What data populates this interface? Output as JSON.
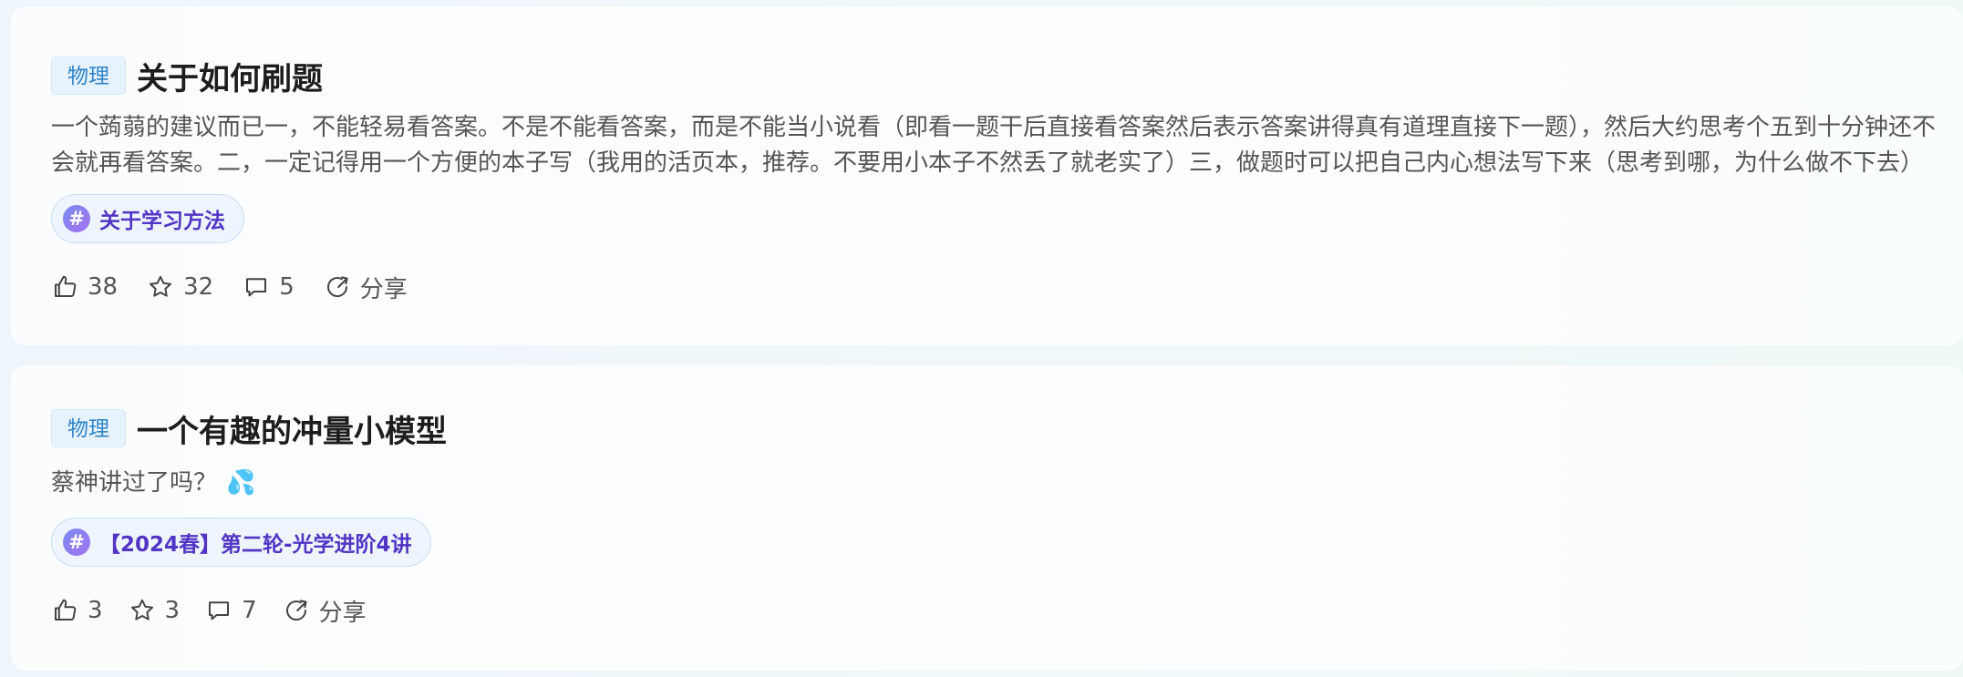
{
  "posts": [
    {
      "subject": "物理",
      "title": "关于如何刷题",
      "excerpt": "一个蒟蒻的建议而已一，不能轻易看答案。不是不能看答案，而是不能当小说看（即看一题干后直接看答案然后表示答案讲得真有道理直接下一题），然后大约思考个五到十分钟还不会就再看答案。二，一定记得用一个方便的本子写（我用的活页本，推荐。不要用小本子不然丢了就老实了）三，做题时可以把自己内心想法写下来（思考到哪，为什么做不下去）",
      "emoji": "",
      "topic": "关于学习方法",
      "likes": "38",
      "stars": "32",
      "comments": "5",
      "share_label": "分享"
    },
    {
      "subject": "物理",
      "title": "一个有趣的冲量小模型",
      "excerpt": "蔡神讲过了吗？",
      "emoji": "💦",
      "topic": "【2024春】第二轮-光学进阶4讲",
      "likes": "3",
      "stars": "3",
      "comments": "7",
      "share_label": "分享"
    }
  ],
  "icons": {
    "like": "thumbs-up-icon",
    "star": "star-icon",
    "comment": "comment-bubble-icon",
    "share": "share-icon",
    "topic": "hash-icon"
  },
  "colors": {
    "subject_text": "#2f84c9",
    "subject_bg": "#e6f3fd",
    "topic_text": "#5235c4",
    "topic_border": "#c8def4"
  }
}
